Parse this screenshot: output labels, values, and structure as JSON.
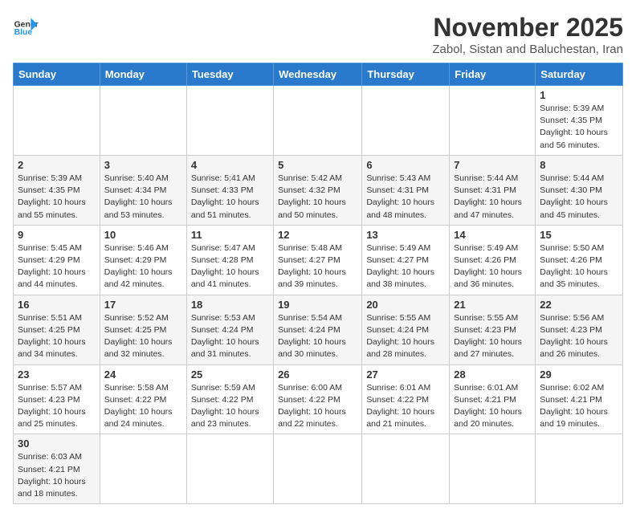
{
  "logo": {
    "text_general": "General",
    "text_blue": "Blue"
  },
  "title": "November 2025",
  "subtitle": "Zabol, Sistan and Baluchestan, Iran",
  "days_of_week": [
    "Sunday",
    "Monday",
    "Tuesday",
    "Wednesday",
    "Thursday",
    "Friday",
    "Saturday"
  ],
  "weeks": [
    [
      {
        "day": "",
        "info": ""
      },
      {
        "day": "",
        "info": ""
      },
      {
        "day": "",
        "info": ""
      },
      {
        "day": "",
        "info": ""
      },
      {
        "day": "",
        "info": ""
      },
      {
        "day": "",
        "info": ""
      },
      {
        "day": "1",
        "info": "Sunrise: 5:39 AM\nSunset: 4:35 PM\nDaylight: 10 hours\nand 56 minutes."
      }
    ],
    [
      {
        "day": "2",
        "info": "Sunrise: 5:39 AM\nSunset: 4:35 PM\nDaylight: 10 hours\nand 55 minutes."
      },
      {
        "day": "3",
        "info": "Sunrise: 5:40 AM\nSunset: 4:34 PM\nDaylight: 10 hours\nand 53 minutes."
      },
      {
        "day": "4",
        "info": "Sunrise: 5:41 AM\nSunset: 4:33 PM\nDaylight: 10 hours\nand 51 minutes."
      },
      {
        "day": "5",
        "info": "Sunrise: 5:42 AM\nSunset: 4:32 PM\nDaylight: 10 hours\nand 50 minutes."
      },
      {
        "day": "6",
        "info": "Sunrise: 5:43 AM\nSunset: 4:31 PM\nDaylight: 10 hours\nand 48 minutes."
      },
      {
        "day": "7",
        "info": "Sunrise: 5:44 AM\nSunset: 4:31 PM\nDaylight: 10 hours\nand 47 minutes."
      },
      {
        "day": "8",
        "info": "Sunrise: 5:44 AM\nSunset: 4:30 PM\nDaylight: 10 hours\nand 45 minutes."
      }
    ],
    [
      {
        "day": "9",
        "info": "Sunrise: 5:45 AM\nSunset: 4:29 PM\nDaylight: 10 hours\nand 44 minutes."
      },
      {
        "day": "10",
        "info": "Sunrise: 5:46 AM\nSunset: 4:29 PM\nDaylight: 10 hours\nand 42 minutes."
      },
      {
        "day": "11",
        "info": "Sunrise: 5:47 AM\nSunset: 4:28 PM\nDaylight: 10 hours\nand 41 minutes."
      },
      {
        "day": "12",
        "info": "Sunrise: 5:48 AM\nSunset: 4:27 PM\nDaylight: 10 hours\nand 39 minutes."
      },
      {
        "day": "13",
        "info": "Sunrise: 5:49 AM\nSunset: 4:27 PM\nDaylight: 10 hours\nand 38 minutes."
      },
      {
        "day": "14",
        "info": "Sunrise: 5:49 AM\nSunset: 4:26 PM\nDaylight: 10 hours\nand 36 minutes."
      },
      {
        "day": "15",
        "info": "Sunrise: 5:50 AM\nSunset: 4:26 PM\nDaylight: 10 hours\nand 35 minutes."
      }
    ],
    [
      {
        "day": "16",
        "info": "Sunrise: 5:51 AM\nSunset: 4:25 PM\nDaylight: 10 hours\nand 34 minutes."
      },
      {
        "day": "17",
        "info": "Sunrise: 5:52 AM\nSunset: 4:25 PM\nDaylight: 10 hours\nand 32 minutes."
      },
      {
        "day": "18",
        "info": "Sunrise: 5:53 AM\nSunset: 4:24 PM\nDaylight: 10 hours\nand 31 minutes."
      },
      {
        "day": "19",
        "info": "Sunrise: 5:54 AM\nSunset: 4:24 PM\nDaylight: 10 hours\nand 30 minutes."
      },
      {
        "day": "20",
        "info": "Sunrise: 5:55 AM\nSunset: 4:24 PM\nDaylight: 10 hours\nand 28 minutes."
      },
      {
        "day": "21",
        "info": "Sunrise: 5:55 AM\nSunset: 4:23 PM\nDaylight: 10 hours\nand 27 minutes."
      },
      {
        "day": "22",
        "info": "Sunrise: 5:56 AM\nSunset: 4:23 PM\nDaylight: 10 hours\nand 26 minutes."
      }
    ],
    [
      {
        "day": "23",
        "info": "Sunrise: 5:57 AM\nSunset: 4:23 PM\nDaylight: 10 hours\nand 25 minutes."
      },
      {
        "day": "24",
        "info": "Sunrise: 5:58 AM\nSunset: 4:22 PM\nDaylight: 10 hours\nand 24 minutes."
      },
      {
        "day": "25",
        "info": "Sunrise: 5:59 AM\nSunset: 4:22 PM\nDaylight: 10 hours\nand 23 minutes."
      },
      {
        "day": "26",
        "info": "Sunrise: 6:00 AM\nSunset: 4:22 PM\nDaylight: 10 hours\nand 22 minutes."
      },
      {
        "day": "27",
        "info": "Sunrise: 6:01 AM\nSunset: 4:22 PM\nDaylight: 10 hours\nand 21 minutes."
      },
      {
        "day": "28",
        "info": "Sunrise: 6:01 AM\nSunset: 4:21 PM\nDaylight: 10 hours\nand 20 minutes."
      },
      {
        "day": "29",
        "info": "Sunrise: 6:02 AM\nSunset: 4:21 PM\nDaylight: 10 hours\nand 19 minutes."
      }
    ],
    [
      {
        "day": "30",
        "info": "Sunrise: 6:03 AM\nSunset: 4:21 PM\nDaylight: 10 hours\nand 18 minutes."
      },
      {
        "day": "",
        "info": ""
      },
      {
        "day": "",
        "info": ""
      },
      {
        "day": "",
        "info": ""
      },
      {
        "day": "",
        "info": ""
      },
      {
        "day": "",
        "info": ""
      },
      {
        "day": "",
        "info": ""
      }
    ]
  ]
}
